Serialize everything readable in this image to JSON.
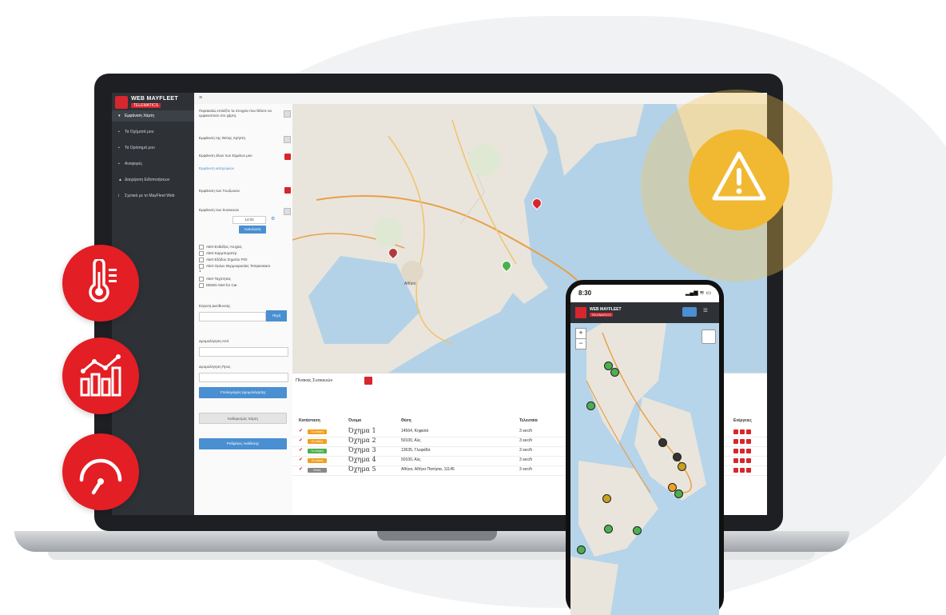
{
  "app": {
    "brand": "WEB MAYFLEET",
    "brand_sub": "TELEMATICS"
  },
  "sidebar": {
    "items": [
      {
        "label": "Εμφάνιση Χάρτη",
        "icon": "map-marker-icon"
      },
      {
        "label": "Τα Οχήματά μου",
        "icon": "car-icon"
      },
      {
        "label": "Τα Ορόσημά μου",
        "icon": "flag-icon"
      },
      {
        "label": "Αναφορές",
        "icon": "chart-icon"
      },
      {
        "label": "Διαχείριση Ειδοποιήσεων",
        "icon": "alert-icon"
      },
      {
        "label": "Σχετικά με το MayFleet Web",
        "icon": "info-icon"
      }
    ]
  },
  "filter_panel": {
    "intro": "Παρακαλώ επιλέξτε τα στοιχεία που θέλετε να εμφανιστούν στο χάρτη.",
    "options": [
      "Εμφάνιση της Θέσης Χρήστη",
      "Εμφάνιση όλων των Σημείων μου",
      "Εμφάνιση των Γεωζωνών",
      "Εμφάνιση των Συσκευών"
    ],
    "options_link": "Εμφάνιση κατηγοριών",
    "time_value": "14:02",
    "refresh_label": "Ανανέωση",
    "alerts": [
      "Alert Ενδείξεις Ατυχίας",
      "Alert Καρμπυρατέρ",
      "Alert Εξόδου Σημείου POI",
      "Alert Ορίων Θερμοκρασίας Temperature 1",
      "Alert Ταχύτητας",
      "DEMO Alert for Car"
    ],
    "search_label": "Εύρεση Διεύθυνσης",
    "search_button": "Πηγή",
    "route_from_label": "Δρομολόγηση Από",
    "route_to_label": "Δρομολόγηση Προς",
    "route_button": "Υπολογισμός Δρομολόγησης",
    "clear_button": "Καθαρισμός Χάρτη",
    "sync_button": "Ρυθμίσεις Ανάθεσης"
  },
  "map": {
    "city_label": "Αθήνα"
  },
  "table": {
    "title": "Πίνακας Συσκευών",
    "headers": {
      "status": "Κατάσταση",
      "name": "Όνομα",
      "location": "Θέση",
      "last": "Τελευταία",
      "actions": "Ενέργειες"
    },
    "rows": [
      {
        "status": "Σε κίνηση",
        "status_color": "#f0a020",
        "name": "Όχημα 1",
        "location": "14564, Κηφισιά",
        "last": "3 sec/h"
      },
      {
        "status": "Σε στάση",
        "status_color": "#f0a020",
        "name": "Όχημα 2",
        "location": "50100, Αλς",
        "last": "3 sec/h"
      },
      {
        "status": "Σε κίνηση",
        "status_color": "#4caf50",
        "name": "Όχημα 3",
        "location": "13635, Γλυφάδα",
        "last": "3 sec/h"
      },
      {
        "status": "Σε στάση",
        "status_color": "#f0a020",
        "name": "Όχημα 4",
        "location": "50100, Αλς",
        "last": "3 sec/h"
      },
      {
        "status": "Εκτός",
        "status_color": "#888888",
        "name": "Όχημα 5",
        "location": "Αθήνα, Αθήνα Πατήσια, 11145",
        "last": "3 sec/h"
      }
    ]
  },
  "phone": {
    "time": "8:30",
    "status_icons": "▂▄▆ ≋ ▭",
    "zoom_in": "+",
    "zoom_out": "−"
  },
  "features": [
    {
      "icon": "thermometer-icon"
    },
    {
      "icon": "bar-chart-icon"
    },
    {
      "icon": "speedometer-icon"
    }
  ],
  "colors": {
    "brand_red": "#e31e24",
    "warning": "#f1b832",
    "sidebar": "#2e3237",
    "accent_blue": "#4a8fd1"
  }
}
